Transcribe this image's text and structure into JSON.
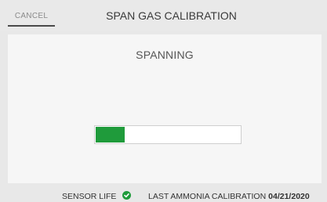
{
  "header": {
    "cancel_label": "CANCEL",
    "title": "SPAN GAS CALIBRATION"
  },
  "main": {
    "status": "SPANNING",
    "progress_fraction": 0.2
  },
  "footer": {
    "sensor_life_label": "SENSOR LIFE",
    "sensor_life_icon": "check-circle-icon",
    "last_calibration_label": "LAST AMMONIA CALIBRATION",
    "last_calibration_date": "04/21/2020"
  },
  "colors": {
    "accent": "#1f9b3b"
  }
}
